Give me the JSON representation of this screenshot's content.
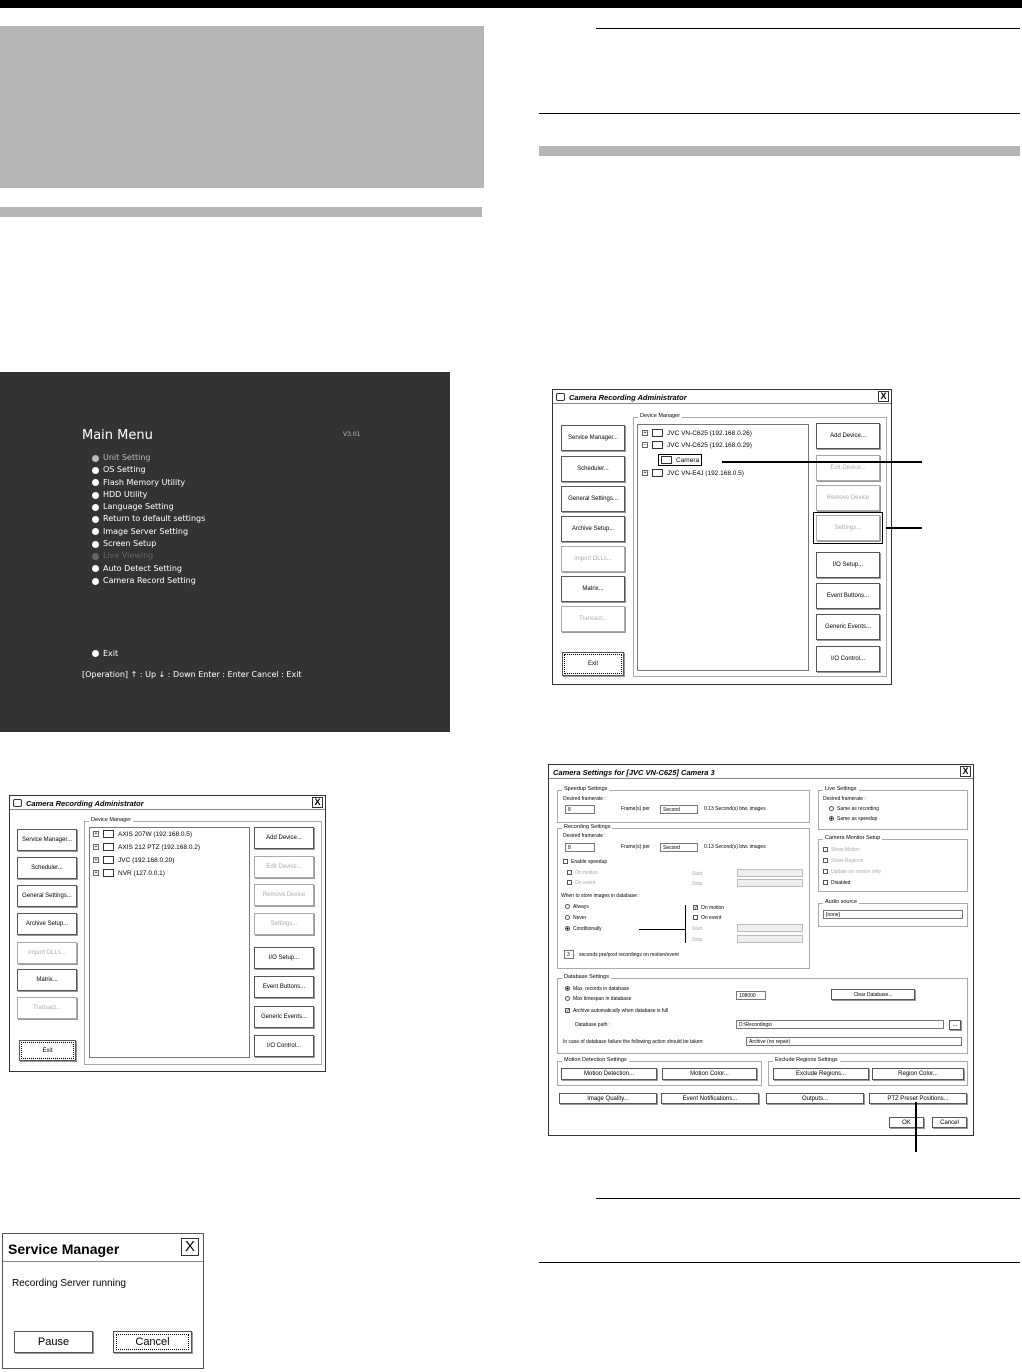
{
  "main_menu": {
    "title": "Main Menu",
    "version": "V3.01",
    "items": [
      "Unit Setting",
      "OS Setting",
      "Flash Memory Utility",
      "HDD Utility",
      "Language Setting",
      "Return to default settings",
      "Image Server Setting",
      "Screen Setup",
      "Live Viewing",
      "Auto Detect Setting",
      "Camera Record Setting"
    ],
    "exit": "Exit",
    "operation": "[Operation]  ↑ : Up    ↓ : Down    Enter : Enter    Cancel : Exit"
  },
  "cra_small": {
    "title": "Camera Recording Administrator",
    "close": "X",
    "group": "Device Manager",
    "left_buttons": [
      "Service Manager...",
      "Scheduler...",
      "General Settings...",
      "Archive Setup...",
      "Import DLLs...",
      "Matrix...",
      "Transact...",
      "Exit"
    ],
    "right_buttons": [
      "Add Device...",
      "Edit Device...",
      "Remove Device",
      "Settings...",
      "I/O Setup...",
      "Event Buttons...",
      "Generic Events...",
      "I/O Control..."
    ],
    "tree": [
      "AXIS 207W (192.168.0.5)",
      "AXIS 212 PTZ (192.168.0.2)",
      "JVC (192.168.0.20)",
      "NVR (127.0.0.1)"
    ]
  },
  "service_manager": {
    "title": "Service Manager",
    "close": "X",
    "message": "Recording Server running",
    "pause": "Pause",
    "cancel": "Cancel"
  },
  "cra_large": {
    "title": "Camera Recording Administrator",
    "close": "X",
    "group": "Device Manager",
    "left_buttons": [
      "Service Manager...",
      "Scheduler...",
      "General Settings...",
      "Archive Setup...",
      "Import DLLs...",
      "Matrix...",
      "Transact...",
      "Exit"
    ],
    "right_buttons": [
      "Add Device...",
      "Edit Device...",
      "Remove Device",
      "Settings...",
      "I/O Setup...",
      "Event Buttons...",
      "Generic Events...",
      "I/O Control..."
    ],
    "tree": [
      "JVC VN-C625 (192.168.0.26)",
      "JVC VN-C625 (192.168.0.29)",
      "Camera",
      "JVC VN-E4J (192.168.0.5)"
    ]
  },
  "cam_settings": {
    "title": "Camera Settings for [JVC VN-C625] Camera 3",
    "close": "X",
    "speedup": {
      "group": "Speedup Settings",
      "desired": "Desired framerate :",
      "value": "8",
      "per": "Frame(s) per",
      "unit": "Second",
      "info": "0.13 Second(s) btw. images"
    },
    "recording": {
      "group": "Recording Settings",
      "desired": "Desired framerate :",
      "value": "8",
      "per": "Frame(s) per",
      "unit": "Second",
      "info": "0.13 Second(s) btw. images",
      "enable_speedup": "Enable speedup",
      "on_motion": "On motion",
      "on_event": "On event",
      "start": "Start",
      "stop": "Stop",
      "when": "When to store images in database :",
      "always": "Always",
      "never": "Never",
      "conditionally": "Conditionally",
      "on_motion2": "On motion",
      "on_event2": "On event",
      "start2": "Start",
      "stop2": "Stop",
      "seconds_value": "3",
      "seconds_label": "seconds pre/post recordings on motion/event"
    },
    "live": {
      "group": "Live Settings",
      "desired": "Desired framerate :",
      "same_rec": "Same as recording",
      "same_speed": "Same as speedup"
    },
    "monitor": {
      "group": "Camera Monitor Setup",
      "show_motion": "Show Motion",
      "show_regions": "Show Regions",
      "update": "Update on motion only",
      "disabled": "Disabled"
    },
    "audio": {
      "group": "Audio source",
      "value": "[none]"
    },
    "database": {
      "group": "Database Settings",
      "max_records": "Max. records in database",
      "max_timespan": "Max timespan in database",
      "records_value": "108000",
      "clear": "Clear Database...",
      "archive": "Archive automatically when database is full",
      "path_label": "Database path :",
      "path_value": "D:\\Recordings\\",
      "browse": "...",
      "failure_label": "In case of database failure the following action should be taken:",
      "failure_value": "Archive (no repair)"
    },
    "motion": {
      "group": "Motion Detection Settings",
      "detection": "Motion Detection...",
      "color": "Motion Color..."
    },
    "exclude": {
      "group": "Exclude Regions Settings",
      "regions": "Exclude Regions...",
      "color": "Region Color..."
    },
    "bottom": [
      "Image Quality...",
      "Event Notifications...",
      "Outputs...",
      "PTZ Preset Positions..."
    ],
    "ok": "OK",
    "cancel": "Cancel"
  }
}
